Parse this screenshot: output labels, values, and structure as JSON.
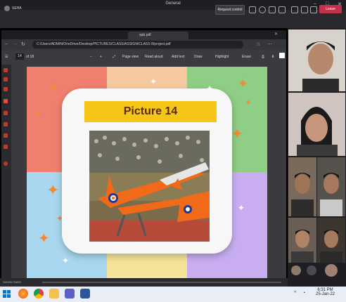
{
  "window": {
    "title": "General"
  },
  "meeting": {
    "sharer_name": "SEHA",
    "request_control": "Request control",
    "leave": "Leave"
  },
  "browser": {
    "tab_title": "qab.pdf",
    "url": "C:/Users/ADMIN/OneDrive/Desktop/PICTURES/CLASS/ASSIGN/CLASS 8/project.pdf"
  },
  "pdf_toolbar": {
    "page_number": "14",
    "page_total": "of 18",
    "page_view": "Page view",
    "read_aloud": "Read aloud",
    "add_text": "Add text",
    "draw": "Draw",
    "highlight": "Highlight",
    "erase": "Erase"
  },
  "slide": {
    "title": "Picture 14",
    "colors": {
      "red": "#f07f6f",
      "peach": "#f7c9a0",
      "green": "#8fce85",
      "blue": "#a9d7ef",
      "yellow": "#f6e39a",
      "purple": "#c8aef1",
      "banner": "#f5c518"
    }
  },
  "share_footer": {
    "presenter": "SAHAN SABO"
  },
  "taskbar": {
    "time": "6:31 PM",
    "date": "25-Jan-22"
  }
}
